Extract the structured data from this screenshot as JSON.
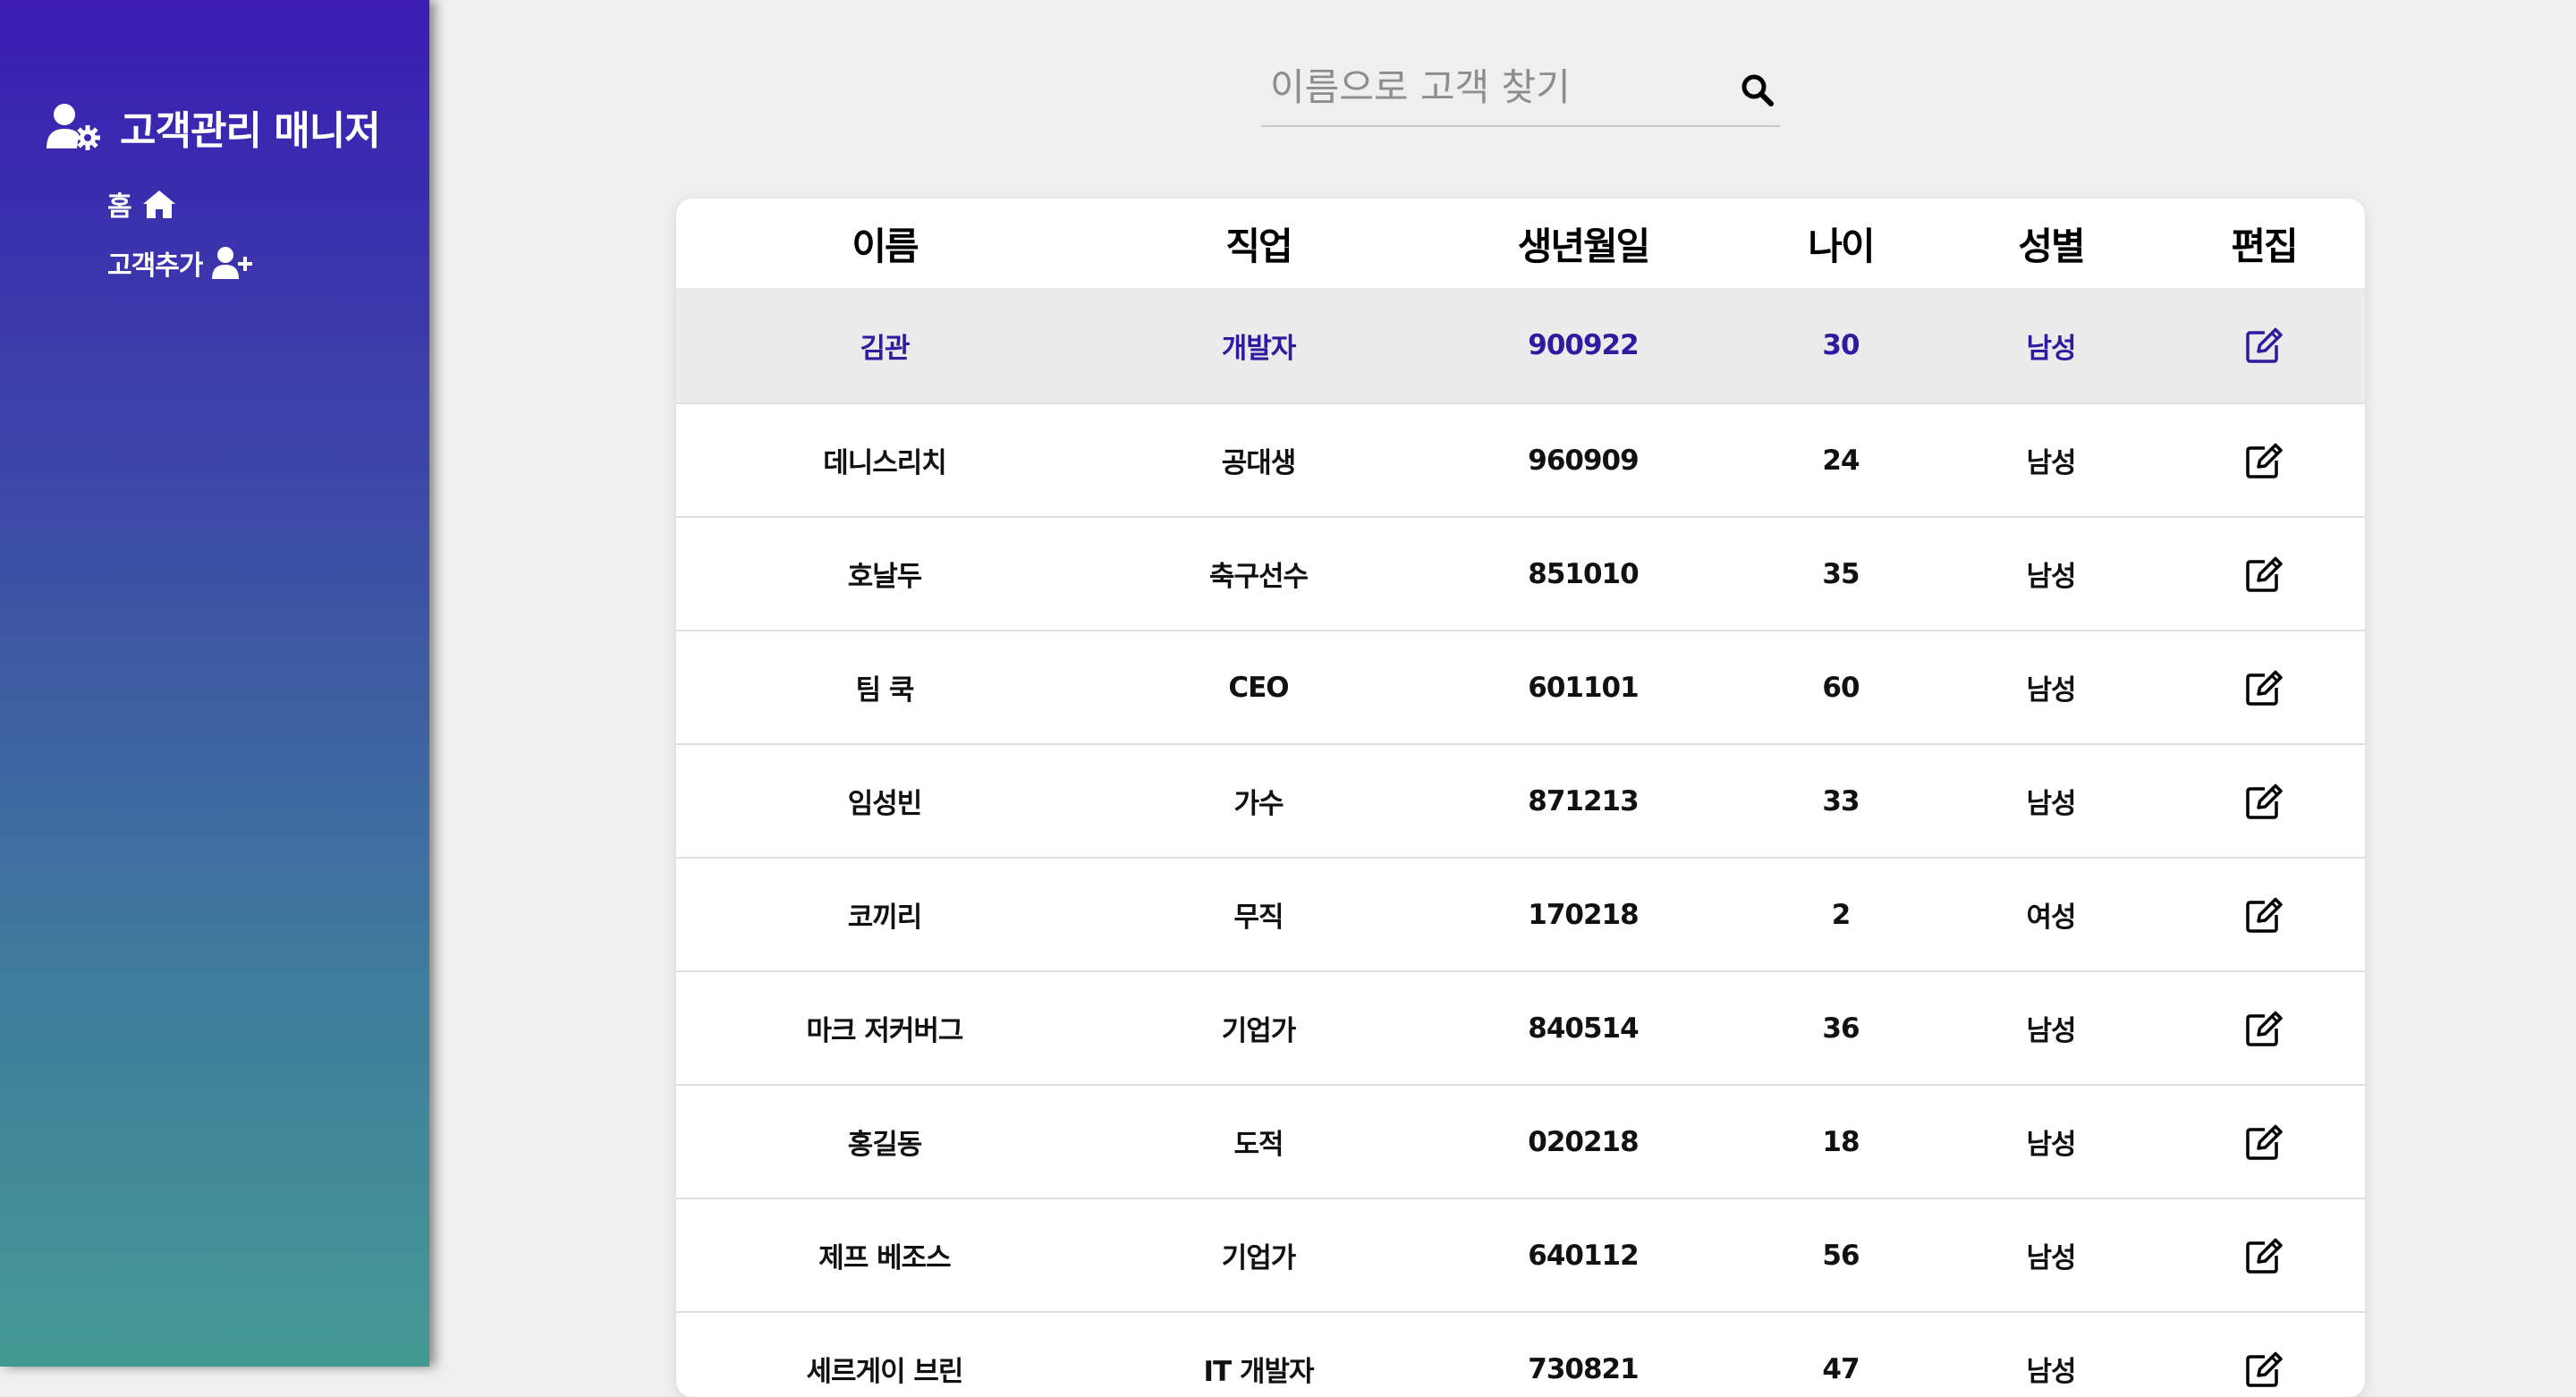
{
  "app": {
    "title": "고객관리 매니저"
  },
  "sidebar": {
    "items": [
      {
        "label": "홈",
        "icon": "home-icon"
      },
      {
        "label": "고객추가",
        "icon": "user-plus-icon"
      }
    ]
  },
  "search": {
    "placeholder": "이름으로 고객 찾기",
    "value": ""
  },
  "table": {
    "headers": [
      "이름",
      "직업",
      "생년월일",
      "나이",
      "성별",
      "편집"
    ],
    "rows": [
      {
        "name": "김관",
        "job": "개발자",
        "birth": "900922",
        "age": "30",
        "gender": "남성"
      },
      {
        "name": "데니스리치",
        "job": "공대생",
        "birth": "960909",
        "age": "24",
        "gender": "남성"
      },
      {
        "name": "호날두",
        "job": "축구선수",
        "birth": "851010",
        "age": "35",
        "gender": "남성"
      },
      {
        "name": "팀 쿡",
        "job": "CEO",
        "birth": "601101",
        "age": "60",
        "gender": "남성"
      },
      {
        "name": "임성빈",
        "job": "가수",
        "birth": "871213",
        "age": "33",
        "gender": "남성"
      },
      {
        "name": "코끼리",
        "job": "무직",
        "birth": "170218",
        "age": "2",
        "gender": "여성"
      },
      {
        "name": "마크 저커버그",
        "job": "기업가",
        "birth": "840514",
        "age": "36",
        "gender": "남성"
      },
      {
        "name": "홍길동",
        "job": "도적",
        "birth": "020218",
        "age": "18",
        "gender": "남성"
      },
      {
        "name": "제프 베조스",
        "job": "기업가",
        "birth": "640112",
        "age": "56",
        "gender": "남성"
      },
      {
        "name": "세르게이 브린",
        "job": "IT 개발자",
        "birth": "730821",
        "age": "47",
        "gender": "남성"
      }
    ],
    "edit_icon": "edit-icon",
    "highlighted_row": 0
  },
  "colors": {
    "sidebar_top": "#3a1cb3",
    "sidebar_bottom": "#439a94",
    "highlight_text": "#2f1aa0",
    "highlight_bg": "#ebebeb",
    "page_bg": "#efefef"
  }
}
